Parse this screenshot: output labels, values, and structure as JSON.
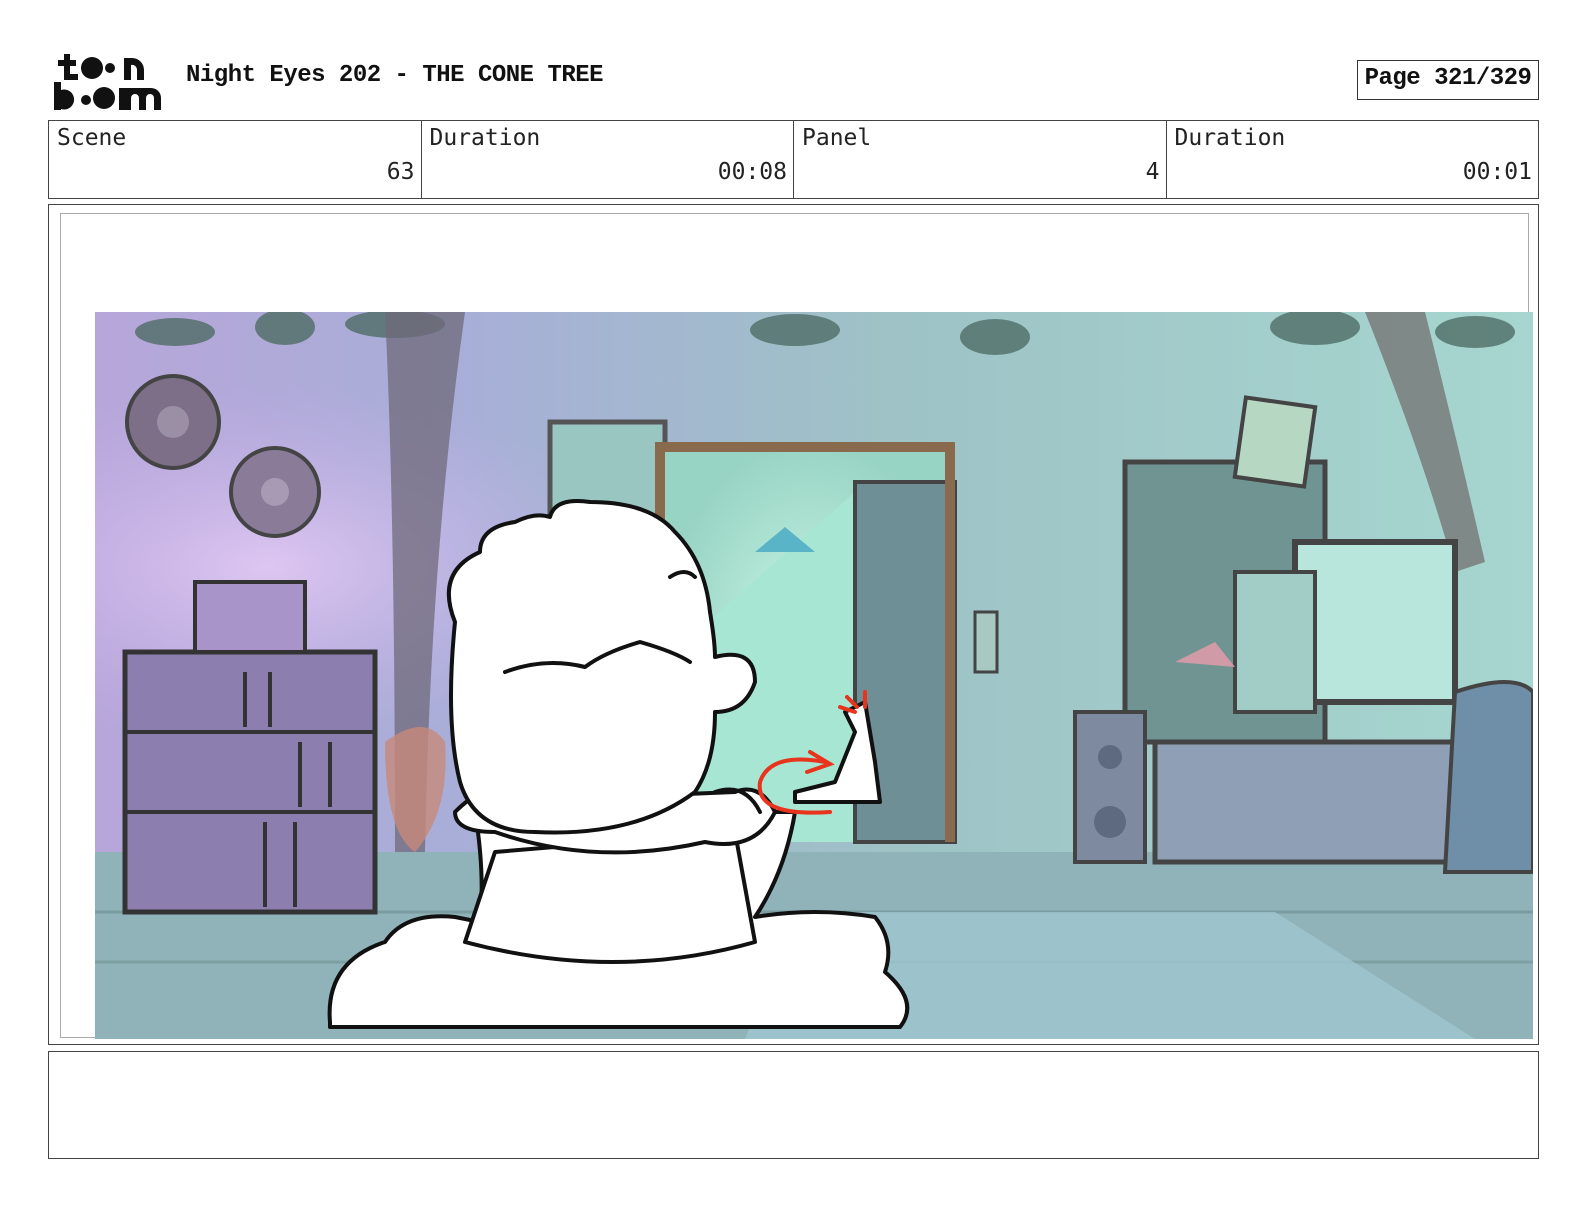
{
  "header": {
    "logo_text": "toon boom",
    "title": "Night Eyes 202 - THE CONE TREE",
    "page": "Page 321/329"
  },
  "info": {
    "scene_label": "Scene",
    "scene_value": "63",
    "scene_duration_label": "Duration",
    "scene_duration_value": "00:08",
    "panel_label": "Panel",
    "panel_value": "4",
    "panel_duration_label": "Duration",
    "panel_duration_value": "00:01"
  },
  "notes": {
    "text": ""
  },
  "colors": {
    "wall_teal": "#9fc9c2",
    "wall_purple": "#b7a6d9",
    "floor": "#8fbfb8",
    "line_art": "#111111",
    "red_annotation": "#e8341c"
  }
}
